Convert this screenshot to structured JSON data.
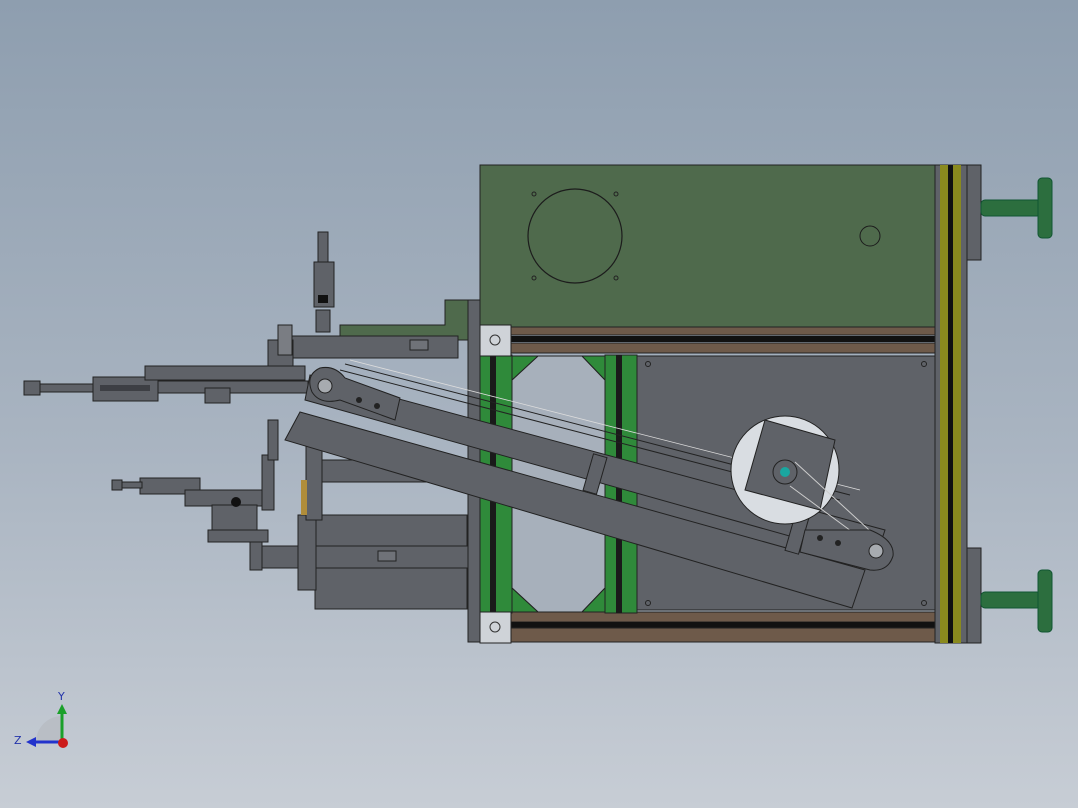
{
  "viewport": {
    "background_top": "#8e9eaf",
    "background_bottom": "#c7cdd5"
  },
  "model": {
    "plate_green": "#4f6a4c",
    "plate_grey": "#5f6268",
    "frame_green": "#2f8a3a",
    "rail_brown": "#6e5a4a",
    "rail_olive": "#8a8a1e",
    "foot_green": "#2c6e3e",
    "motor_accent": "#1aa7a0"
  },
  "triad": {
    "y_label": "Y",
    "z_label": "Z",
    "y_color": "#1aa02a",
    "z_color": "#2233cc",
    "x_color": "#cc1a1a"
  }
}
